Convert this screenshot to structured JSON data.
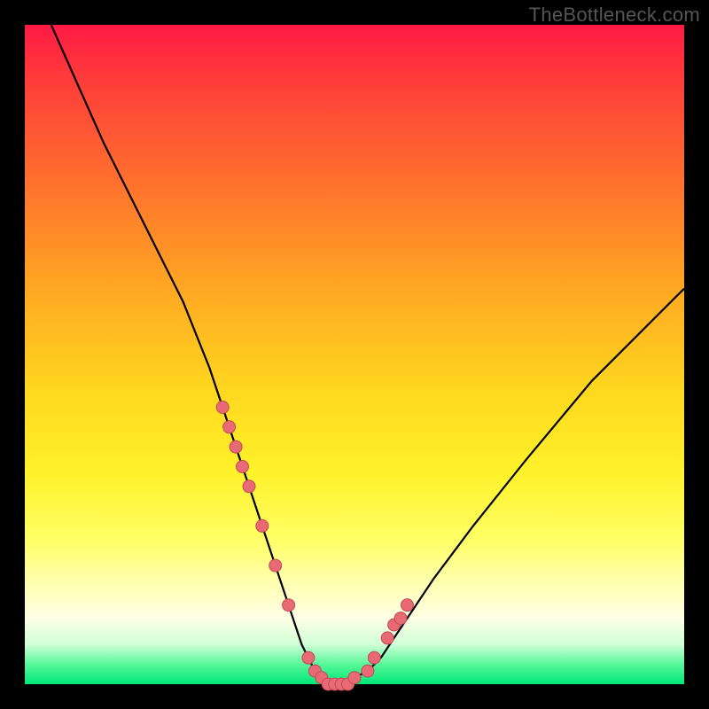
{
  "watermark": {
    "text": "TheBottleneck.com"
  },
  "colors": {
    "background": "#000000",
    "curve": "#000000",
    "marker_fill": "#e86a74",
    "marker_stroke": "#c24a56",
    "gradient_top": "#ff1a44",
    "gradient_bottom": "#00e676"
  },
  "chart_data": {
    "type": "line",
    "title": "",
    "xlabel": "",
    "ylabel": "",
    "xlim": [
      0,
      100
    ],
    "ylim": [
      0,
      100
    ],
    "grid": false,
    "series": [
      {
        "name": "bottleneck-curve",
        "x": [
          4,
          8,
          12,
          16,
          20,
          24,
          28,
          30,
          32,
          34,
          36,
          38,
          40,
          41,
          42,
          43,
          44,
          45,
          46,
          47,
          48,
          50,
          52,
          54,
          56,
          58,
          62,
          68,
          76,
          86,
          96,
          100
        ],
        "y": [
          100,
          91,
          82,
          74,
          66,
          58,
          48,
          42,
          36,
          30,
          24,
          18,
          12,
          9,
          6,
          4,
          2,
          1,
          0,
          0,
          0,
          1,
          2,
          4,
          7,
          10,
          16,
          24,
          34,
          46,
          56,
          60
        ]
      }
    ],
    "markers": {
      "name": "highlight-points",
      "x": [
        30,
        31,
        32,
        33,
        34,
        36,
        38,
        40,
        43,
        44,
        45,
        46,
        47,
        48,
        49,
        50,
        52,
        53,
        55,
        56,
        57,
        58
      ],
      "y": [
        42,
        39,
        36,
        33,
        30,
        24,
        18,
        12,
        4,
        2,
        1,
        0,
        0,
        0,
        0,
        1,
        2,
        4,
        7,
        9,
        10,
        12
      ]
    }
  }
}
